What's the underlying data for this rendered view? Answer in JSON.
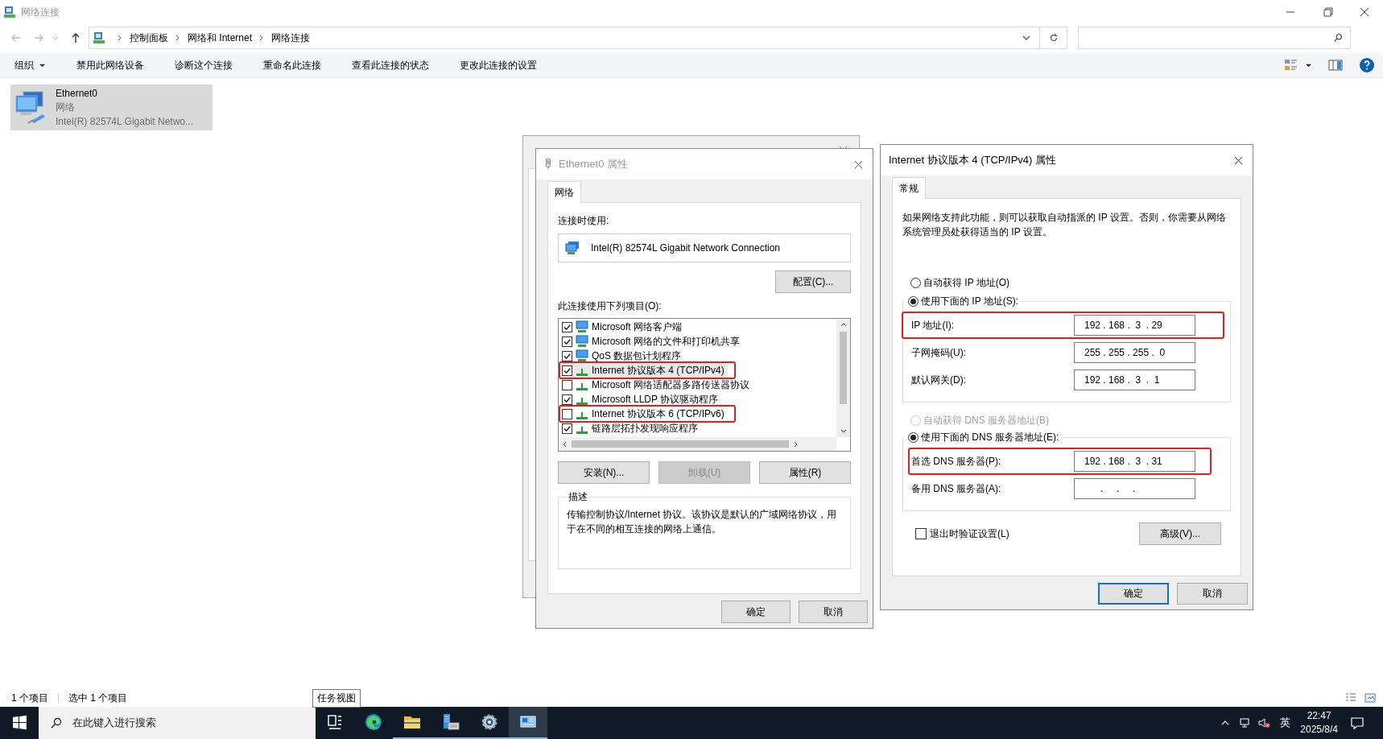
{
  "window": {
    "title": "网络连接"
  },
  "address_bar": {
    "breadcrumbs": [
      "控制面板",
      "网络和 Internet",
      "网络连接"
    ]
  },
  "toolbar": {
    "items": [
      {
        "label": "组织",
        "kind": "menu"
      },
      {
        "label": "禁用此网络设备",
        "kind": "command"
      },
      {
        "label": "诊断这个连接",
        "kind": "command"
      },
      {
        "label": "重命名此连接",
        "kind": "command"
      },
      {
        "label": "查看此连接的状态",
        "kind": "command"
      },
      {
        "label": "更改此连接的设置",
        "kind": "command"
      }
    ]
  },
  "connections": [
    {
      "name": "Ethernet0",
      "status": "网络",
      "adapter": "Intel(R) 82574L Gigabit Netwo...",
      "selected": true
    }
  ],
  "status_bar": {
    "count": "1 个项目",
    "selection": "选中 1 个项目"
  },
  "properties_dialog": {
    "title": "Ethernet0 属性",
    "tabs": [
      {
        "label": "网络",
        "selected": true
      }
    ],
    "connect_using_label": "连接时使用:",
    "adapter": "Intel(R) 82574L Gigabit Network Connection",
    "configure_button": "配置(C)...",
    "items_label": "此连接使用下列项目(O):",
    "items": [
      {
        "label": "Microsoft 网络客户端",
        "kind": "monitor",
        "checked": true,
        "selected": false,
        "highlighted": false
      },
      {
        "label": "Microsoft 网络的文件和打印机共享",
        "kind": "monitor",
        "checked": true,
        "selected": false,
        "highlighted": false
      },
      {
        "label": "QoS 数据包计划程序",
        "kind": "monitor",
        "checked": true,
        "selected": false,
        "highlighted": false
      },
      {
        "label": "Internet 协议版本 4 (TCP/IPv4)",
        "kind": "protocol",
        "checked": true,
        "selected": true,
        "highlighted": true
      },
      {
        "label": "Microsoft 网络适配器多路传送器协议",
        "kind": "protocol",
        "checked": false,
        "selected": false,
        "highlighted": false
      },
      {
        "label": "Microsoft LLDP 协议驱动程序",
        "kind": "protocol",
        "checked": true,
        "selected": false,
        "highlighted": false
      },
      {
        "label": "Internet 协议版本 6 (TCP/IPv6)",
        "kind": "protocol",
        "checked": false,
        "selected": false,
        "highlighted": true
      },
      {
        "label": "链路层拓扑发现响应程序",
        "kind": "protocol",
        "checked": true,
        "selected": false,
        "highlighted": false
      }
    ],
    "buttons": [
      {
        "label": "安装(N)...",
        "disabled": false
      },
      {
        "label": "卸载(U)",
        "disabled": true
      },
      {
        "label": "属性(R)",
        "disabled": false
      }
    ],
    "description_title": "描述",
    "description": "传输控制协议/Internet 协议。该协议是默认的广域网络协议，用于在不同的相互连接的网络上通信。",
    "footer_buttons": [
      {
        "label": "确定",
        "default": false
      },
      {
        "label": "取消",
        "default": false
      }
    ]
  },
  "ipv4_dialog": {
    "title": "Internet 协议版本 4 (TCP/IPv4) 属性",
    "tabs": [
      {
        "label": "常规",
        "selected": true
      }
    ],
    "intro": "如果网络支持此功能，则可以获取自动指派的 IP 设置。否则，你需要从网络系统管理员处获得适当的 IP 设置。",
    "ip_modes": [
      {
        "label": "自动获得 IP 地址(O)",
        "selected": false,
        "disabled": false
      },
      {
        "label": "使用下面的 IP 地址(S):",
        "selected": true,
        "disabled": false
      }
    ],
    "ip_fields": [
      {
        "label": "IP 地址(I):",
        "value": "192 . 168 .  3  . 29",
        "highlighted": true
      },
      {
        "label": "子网掩码(U):",
        "value": "255 . 255 . 255 .  0",
        "highlighted": false
      },
      {
        "label": "默认网关(D):",
        "value": "192 . 168 .  3  .  1",
        "highlighted": false
      }
    ],
    "dns_modes": [
      {
        "label": "自动获得 DNS 服务器地址(B)",
        "selected": false,
        "disabled": true
      },
      {
        "label": "使用下面的 DNS 服务器地址(E):",
        "selected": true,
        "disabled": false
      }
    ],
    "dns_fields": [
      {
        "label": "首选 DNS 服务器(P):",
        "value": "192 . 168 .  3  . 31",
        "highlighted": true
      },
      {
        "label": "备用 DNS 服务器(A):",
        "value": "      .     .     .",
        "highlighted": false
      }
    ],
    "validate_on_exit": {
      "label": "退出时验证设置(L)",
      "checked": false
    },
    "advanced_button": "高级(V)...",
    "footer_buttons": [
      {
        "label": "确定",
        "default": true
      },
      {
        "label": "取消",
        "default": false
      }
    ]
  },
  "tooltip": "任务视图",
  "taskbar": {
    "search_placeholder": "在此键入进行搜索",
    "apps": [
      {
        "kind": "task_view",
        "running": false,
        "active": false
      },
      {
        "kind": "browser",
        "running": false,
        "active": false
      },
      {
        "kind": "folder",
        "running": true,
        "active": false
      },
      {
        "kind": "server",
        "running": true,
        "active": false
      },
      {
        "kind": "gear",
        "running": true,
        "active": false
      },
      {
        "kind": "network",
        "running": true,
        "active": true
      }
    ],
    "ime": "英",
    "time": "22:47",
    "date": "2025/8/4"
  }
}
